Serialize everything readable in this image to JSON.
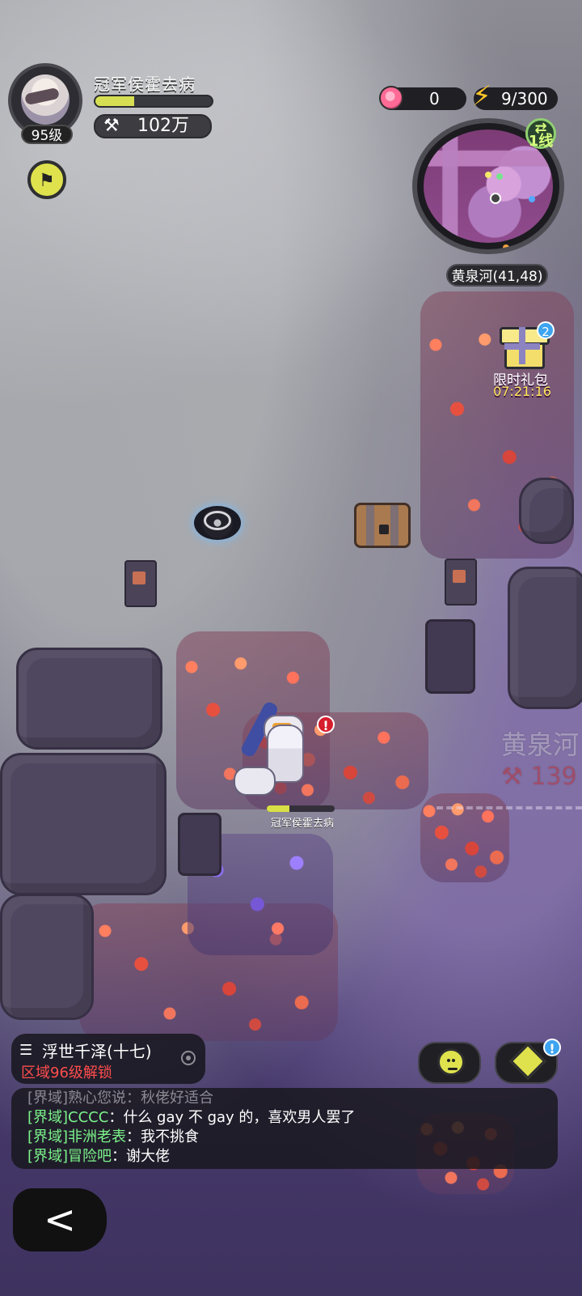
{
  "hud": {
    "player_name": "冠军侯霍去病",
    "level": "95级",
    "power": "102万",
    "peach_count": "0",
    "energy": "9/300"
  },
  "map": {
    "line_badge": "1线",
    "location": "黄泉河(41,48)"
  },
  "promo": {
    "title": "限时礼包",
    "timer": "07:21:16",
    "badge_count": "2"
  },
  "battlefield": {
    "player_label": "冠军侯霍去病",
    "warning": "!",
    "offscreen_zone": "黄泉河",
    "offscreen_power": "139"
  },
  "chat": {
    "channel": "浮世千泽(十七)",
    "unlock": "区域96级解锁",
    "faded_message": "[界域]熟心您说：秋佬好适合",
    "messages": [
      {
        "tag": "[界域]",
        "user": "CCCC",
        "text": "：什么 gay 不 gay 的，喜欢男人罢了"
      },
      {
        "tag": "[界域]",
        "user": "非洲老表",
        "text": "：我不挑食"
      },
      {
        "tag": "[界域]",
        "user": "冒险吧",
        "text": "：谢大佬"
      }
    ]
  },
  "buttons": {
    "back": "<",
    "box_alert": "!"
  }
}
